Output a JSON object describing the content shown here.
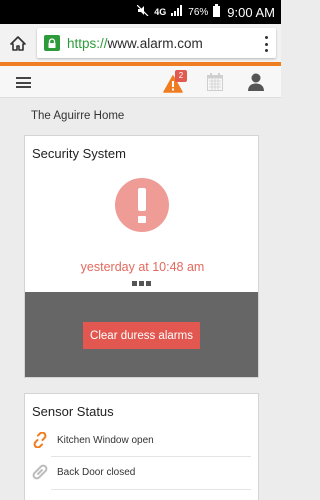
{
  "status_bar": {
    "network": "4G",
    "battery": "76%",
    "time": "9:00 AM"
  },
  "browser": {
    "url_scheme": "https://",
    "url_host": "www.alarm.com"
  },
  "header": {
    "alert_count": "2"
  },
  "home_name": "The Aguirre Home",
  "security": {
    "title": "Security System",
    "event_time": "yesterday at 10:48 am",
    "action_label": "Clear duress alarms"
  },
  "sensors": {
    "title": "Sensor Status",
    "items": [
      {
        "label": "Kitchen Window open",
        "icon": "link-open-icon"
      },
      {
        "label": "Back Door closed",
        "icon": "link-closed-icon"
      }
    ]
  },
  "colors": {
    "brand_orange": "#ef7d22",
    "alert_red": "#e25850",
    "alert_pink": "#ef9b96",
    "https_green": "#2e9b3a"
  }
}
